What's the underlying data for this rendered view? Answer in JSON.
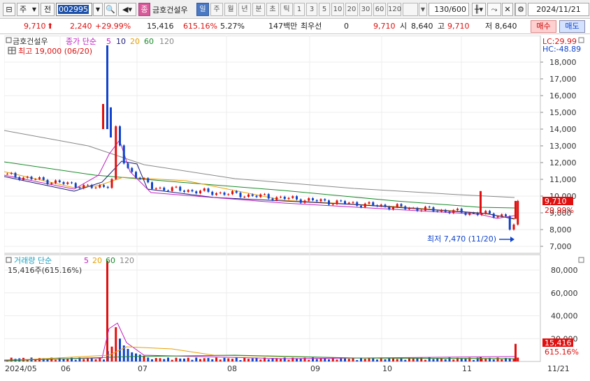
{
  "toolbar": {
    "market_select": "주",
    "prev_label": "전",
    "code": "002995",
    "stock_name": "금호건설우",
    "name_badge": "종",
    "periods": [
      "일",
      "주",
      "월",
      "년",
      "분",
      "초",
      "틱"
    ],
    "active_period": "일",
    "intervals": [
      "1",
      "3",
      "5",
      "10",
      "20",
      "30",
      "60",
      "120"
    ],
    "count": "130",
    "count_total": "/600",
    "date": "2024/11/21"
  },
  "quote": {
    "price": "9,710",
    "change": "2,240",
    "change_pct": "+29.99%",
    "volume": "15,416",
    "volume_ratio": "615.16%",
    "turnover": "5.27%",
    "amount": "147백만",
    "preferred_label": "최우선",
    "preferred_value": "0",
    "best_price": "9,710",
    "open_label": "시",
    "open": "8,640",
    "high_label": "고",
    "high": "9,710",
    "low_label": "저",
    "low": "8,640",
    "buy_label": "매수",
    "sell_label": "매도"
  },
  "price_panel": {
    "name_tag": "금호건설우",
    "indicator_label": "종가 단순",
    "ma_periods": [
      "5",
      "10",
      "20",
      "60",
      "120"
    ],
    "high_note": "최고 19,000 (06/20)",
    "low_note": "최저 7,470 (11/20)",
    "lc_label": "LC:29.99",
    "hc_label": "HC:-48.89",
    "last_price_tag": "9,710",
    "last_pct_tag": "29.99%",
    "y_ticks": [
      "18,000",
      "17,000",
      "16,000",
      "15,000",
      "14,000",
      "13,000",
      "12,000",
      "11,000",
      "10,000",
      "9,000",
      "8,000",
      "7,000"
    ]
  },
  "volume_panel": {
    "indicator_label": "거래량 단순",
    "ma_periods": [
      "5",
      "20",
      "60",
      "120"
    ],
    "current_note": "15,416주(615.16%)",
    "last_volume_tag": "15,416",
    "last_pct_tag": "615.16%",
    "y_ticks": [
      "80,000",
      "60,000",
      "40,000",
      "20,000"
    ]
  },
  "x_axis": {
    "labels": [
      "2024/05",
      "06",
      "07",
      "08",
      "09",
      "10",
      "11",
      "11/21"
    ]
  },
  "colors": {
    "up": "#e01010",
    "down": "#1144cc",
    "ma5": "#c020c0",
    "ma10": "#1a1a7a",
    "ma20": "#e8a000",
    "ma60": "#1a8a2a",
    "ma120": "#888888"
  },
  "chart_data": {
    "type": "candlestick",
    "price_series": [
      {
        "period": "2024/05",
        "approx_close": 11300
      },
      {
        "period": "06",
        "approx_close": 10500
      },
      {
        "period": "06/20 peak",
        "approx_high": 19000
      },
      {
        "period": "07",
        "approx_close": 10600
      },
      {
        "period": "08",
        "approx_close": 9800
      },
      {
        "period": "09",
        "approx_close": 9500
      },
      {
        "period": "10",
        "approx_close": 9100
      },
      {
        "period": "11/20 low",
        "approx_low": 7470
      },
      {
        "period": "11/21",
        "close": 9710,
        "open": 8640,
        "high": 9710,
        "low": 8640
      }
    ],
    "ylim": [
      6800,
      18800
    ],
    "volume_ylim": [
      0,
      90000
    ]
  }
}
